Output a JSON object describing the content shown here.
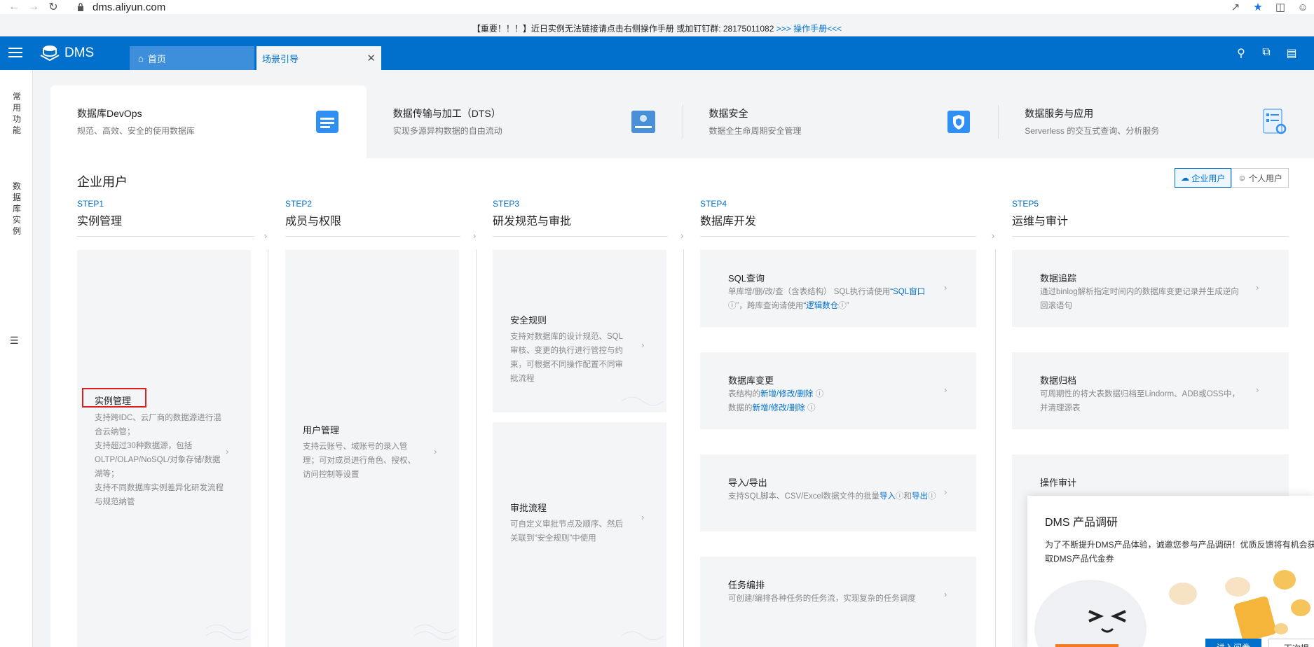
{
  "browser": {
    "url": "dms.aliyun.com"
  },
  "notice": {
    "text": "【重要！！！】近日实例无法链接请点击右侧操作手册 或加钉钉群: 28175011082 ",
    "link": ">>> 操作手册<<<"
  },
  "topbar": {
    "logo": "DMS",
    "tabs": [
      {
        "label": "首页"
      },
      {
        "label": "场景引导"
      }
    ]
  },
  "leftrail": {
    "items": [
      {
        "label": "常用功能"
      },
      {
        "label": "数据库实例"
      }
    ]
  },
  "scenes": [
    {
      "title": "数据库DevOps",
      "sub": "规范、高效、安全的使用数据库"
    },
    {
      "title": "数据传输与加工（DTS）",
      "sub": "实现多源异构数据的自由流动"
    },
    {
      "title": "数据安全",
      "sub": "数据全生命周期安全管理"
    },
    {
      "title": "数据服务与应用",
      "sub": "Serverless 的交互式查询、分析服务"
    }
  ],
  "main": {
    "heading": "企业用户",
    "switch": [
      "企业用户",
      "个人用户"
    ],
    "steps": [
      {
        "num": "STEP1",
        "title": "实例管理"
      },
      {
        "num": "STEP2",
        "title": "成员与权限"
      },
      {
        "num": "STEP3",
        "title": "研发规范与审批"
      },
      {
        "num": "STEP4",
        "title": "数据库开发"
      },
      {
        "num": "STEP5",
        "title": "运维与审计"
      }
    ],
    "cards": {
      "instance": {
        "title": "实例管理",
        "desc": "支持跨IDC、云厂商的数据源进行混合云纳管；\n支持超过30种数据源，包括OLTP/OLAP/NoSQL/对象存储/数据湖等；\n支持不同数据库实例差异化研发流程与规范纳管"
      },
      "users": {
        "title": "用户管理",
        "desc": "支持云账号、域账号的录入管理；可对成员进行角色、授权、访问控制等设置"
      },
      "security": {
        "title": "安全规则",
        "desc": "支持对数据库的设计规范、SQL审核、变更的执行进行管控与约束，可根据不同操作配置不同审批流程"
      },
      "approval": {
        "title": "审批流程",
        "desc": "可自定义审批节点及顺序、然后关联到“安全规则”中使用"
      },
      "sql": {
        "title": "SQL查询",
        "desc_a": "单库增/删/改/查（含表结构） SQL执行请使用",
        "link_a": "“SQL窗口",
        "desc_b": "”，跨库查询请使用",
        "link_b": "“逻辑数仓",
        "desc_c": "”"
      },
      "change": {
        "title": "数据库变更",
        "l1_a": "表结构的",
        "l1_link": "新增/修改/删除",
        "l2_a": "数据的",
        "l2_link": "新增/修改/删除"
      },
      "io": {
        "title": "导入/导出",
        "desc_a": "支持SQL脚本、CSV/Excel数据文件的批量",
        "link_a": "导入",
        "desc_b": "和",
        "link_b": "导出"
      },
      "task": {
        "title": "任务编排",
        "desc": "可创建/编排各种任务的任务流，实现复杂的任务调度"
      },
      "track": {
        "title": "数据追踪",
        "desc": "通过binlog解析指定时间内的数据库变更记录并生成逆向回滚语句"
      },
      "archive": {
        "title": "数据归档",
        "desc": "可周期性的将大表数据归档至Lindorm、ADB或OSS中，并清理源表"
      },
      "audit": {
        "title": "操作审计"
      }
    }
  },
  "survey": {
    "title": "DMS 产品调研",
    "desc": "为了不断提升DMS产品体验，诚邀您参与产品调研！优质反馈将有机会获取DMS产品代金券",
    "btn_primary": "进入问卷",
    "btn_secondary": "下次提"
  },
  "colors": {
    "brand": "#0070cc",
    "highlight_box": "#e02020"
  }
}
